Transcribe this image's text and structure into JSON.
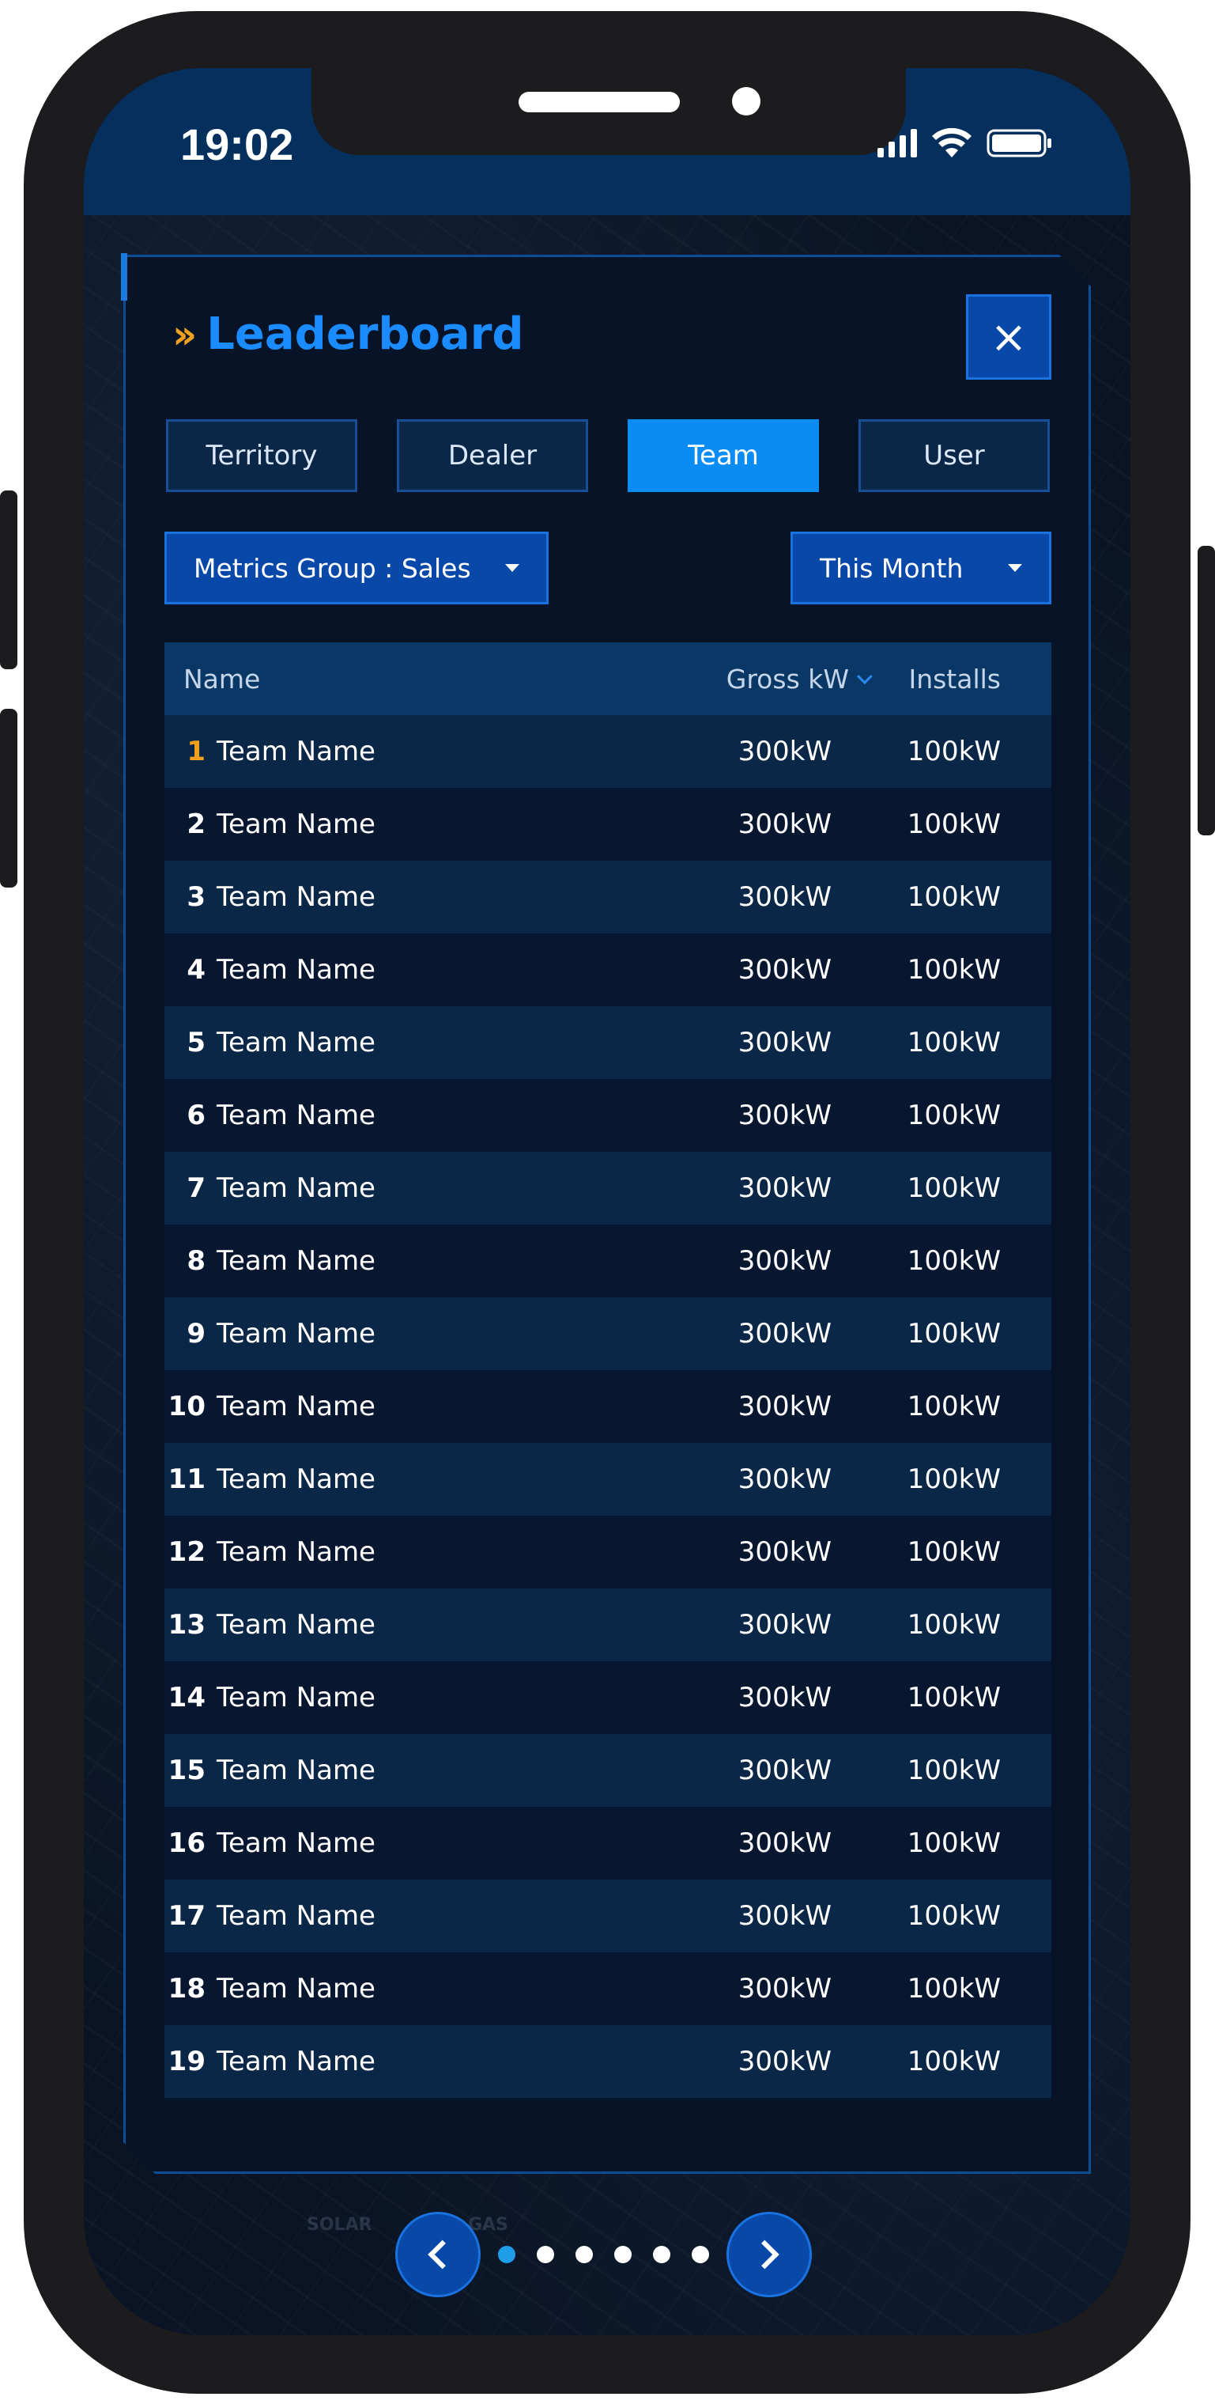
{
  "status_bar": {
    "time": "19:02"
  },
  "leaderboard": {
    "title": "Leaderboard",
    "close_label": "×",
    "tabs": [
      {
        "label": "Territory",
        "active": false
      },
      {
        "label": "Dealer",
        "active": false
      },
      {
        "label": "Team",
        "active": true
      },
      {
        "label": "User",
        "active": false
      }
    ],
    "metrics_dropdown": "Metrics Group : Sales",
    "period_dropdown": "This Month",
    "table": {
      "headers": {
        "name": "Name",
        "gross": "Gross kW",
        "installs": "Installs"
      },
      "rows": [
        {
          "rank": "1",
          "name": "Team Name",
          "gross": "300kW",
          "installs": "100kW"
        },
        {
          "rank": "2",
          "name": "Team Name",
          "gross": "300kW",
          "installs": "100kW"
        },
        {
          "rank": "3",
          "name": "Team Name",
          "gross": "300kW",
          "installs": "100kW"
        },
        {
          "rank": "4",
          "name": "Team Name",
          "gross": "300kW",
          "installs": "100kW"
        },
        {
          "rank": "5",
          "name": "Team Name",
          "gross": "300kW",
          "installs": "100kW"
        },
        {
          "rank": "6",
          "name": "Team Name",
          "gross": "300kW",
          "installs": "100kW"
        },
        {
          "rank": "7",
          "name": "Team Name",
          "gross": "300kW",
          "installs": "100kW"
        },
        {
          "rank": "8",
          "name": "Team Name",
          "gross": "300kW",
          "installs": "100kW"
        },
        {
          "rank": "9",
          "name": "Team Name",
          "gross": "300kW",
          "installs": "100kW"
        },
        {
          "rank": "10",
          "name": "Team Name",
          "gross": "300kW",
          "installs": "100kW"
        },
        {
          "rank": "11",
          "name": "Team Name",
          "gross": "300kW",
          "installs": "100kW"
        },
        {
          "rank": "12",
          "name": "Team Name",
          "gross": "300kW",
          "installs": "100kW"
        },
        {
          "rank": "13",
          "name": "Team Name",
          "gross": "300kW",
          "installs": "100kW"
        },
        {
          "rank": "14",
          "name": "Team Name",
          "gross": "300kW",
          "installs": "100kW"
        },
        {
          "rank": "15",
          "name": "Team Name",
          "gross": "300kW",
          "installs": "100kW"
        },
        {
          "rank": "16",
          "name": "Team Name",
          "gross": "300kW",
          "installs": "100kW"
        },
        {
          "rank": "17",
          "name": "Team Name",
          "gross": "300kW",
          "installs": "100kW"
        },
        {
          "rank": "18",
          "name": "Team Name",
          "gross": "300kW",
          "installs": "100kW"
        },
        {
          "rank": "19",
          "name": "Team Name",
          "gross": "300kW",
          "installs": "100kW"
        }
      ]
    }
  },
  "pager": {
    "page_count": 6,
    "active_index": 0
  },
  "background": {
    "label_solar": "SOLAR",
    "label_gas": "GAS"
  },
  "colors": {
    "accent": "#0a8cf5",
    "gold": "#f0a020",
    "title": "#1a8cff",
    "panel": "#071428"
  }
}
